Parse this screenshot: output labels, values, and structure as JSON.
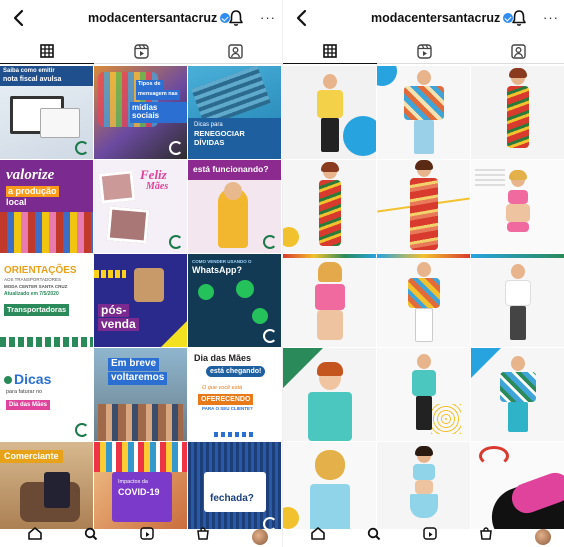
{
  "left": {
    "username": "modacentersantacruz",
    "posts": [
      {
        "lines": [
          "Saiba como emitir",
          "nota fiscal avulsa"
        ]
      },
      {
        "lines": [
          "Tipos de",
          "mensagem nas",
          "mídias sociais"
        ]
      },
      {
        "lines": [
          "Dicas para",
          "RENEGOCIAR",
          "DÍVIDAS"
        ]
      },
      {
        "lines": [
          "valorize",
          "a produção",
          "local"
        ]
      },
      {
        "lines": [
          "Feliz",
          "Mães"
        ]
      },
      {
        "lines": [
          "está funcionando?"
        ]
      },
      {
        "lines": [
          "ORIENTAÇÕES",
          "AOS TRANSPORTADORES",
          "MODA CENTER SANTA CRUZ",
          "Atualizado em 7/5/2020",
          "Transportadoras"
        ]
      },
      {
        "lines": [
          "pós-",
          "venda"
        ]
      },
      {
        "lines": [
          "COMO VENDER USANDO O",
          "WhatsApp?"
        ]
      },
      {
        "lines": [
          "Dicas",
          "para faturar no",
          "Dia das Mães"
        ]
      },
      {
        "lines": [
          "Em breve",
          "voltaremos"
        ]
      },
      {
        "lines": [
          "Dia das Mães",
          "está chegando!",
          "O que você está",
          "OFERECENDO",
          "PARA O SEU CLIENTE?"
        ]
      },
      {
        "lines": [
          "Comerciante"
        ]
      },
      {
        "lines": [
          "Impactos da",
          "COVID-19"
        ]
      },
      {
        "lines": [
          "fechada?"
        ]
      }
    ]
  },
  "right": {
    "username": "modacentersantacruz"
  },
  "icons": {
    "back": "chevron-left-icon",
    "notifications": "bell-icon",
    "more": "more-icon",
    "grid": "grid-icon",
    "reels": "reels-icon",
    "tagged": "tagged-icon"
  },
  "more_label": "···",
  "colors": {
    "verified": "#2f8cf0",
    "brand_green": "#1a7a4a"
  }
}
